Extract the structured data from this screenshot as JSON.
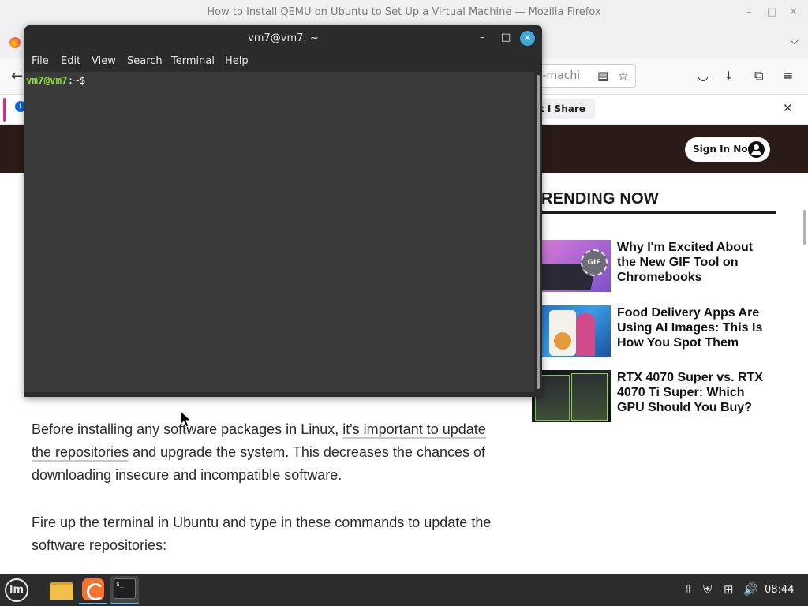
{
  "firefox": {
    "window_title": "How to Install QEMU on Ubuntu to Set Up a Virtual Machine — Mozilla Firefox",
    "minimize_glyph": "–",
    "maximize_glyph": "□",
    "close_glyph": "✕",
    "tab_list_glyph": "⌵",
    "back_glyph": "←",
    "url_visible": "al-machi",
    "reader_glyph": "▤",
    "bookmark_glyph": "☆",
    "pocket_glyph": "◡",
    "download_glyph": "⤓",
    "extensions_glyph": "⧉",
    "menu_glyph": "≡"
  },
  "notification": {
    "info_glyph": "i",
    "share_label": "t I Share",
    "close_glyph": "✕"
  },
  "site": {
    "sign_in_label": "Sign In Now"
  },
  "trending": {
    "title": "RENDING NOW",
    "items": [
      {
        "title": "Why I'm Excited About the New GIF Tool on Chromebooks",
        "thumb_badge": "GIF"
      },
      {
        "title": "Food Delivery Apps Are Using AI Images: This Is How You Spot Them"
      },
      {
        "title": "RTX 4070 Super vs. RTX 4070 Ti Super: Which GPU Should You Buy?"
      }
    ]
  },
  "article": {
    "p1_before": "Before installing any software packages in Linux, ",
    "p1_link": "it's important to update the repositories",
    "p1_after": " and upgrade the system. This decreases the chances of downloading insecure and incompatible software.",
    "p2": "Fire up the terminal in Ubuntu and type in these commands to update the software repositories:"
  },
  "terminal": {
    "title": "vm7@vm7: ~",
    "minimize_glyph": "–",
    "maximize_glyph": "□",
    "close_glyph": "✕",
    "menu": [
      "File",
      "Edit",
      "View",
      "Search",
      "Terminal",
      "Help"
    ],
    "prompt_user": "vm7@vm7",
    "prompt_path": ":~$ "
  },
  "taskbar": {
    "menu_glyph": "lm",
    "terminal_icon_text": "$_",
    "tray": {
      "update_glyph": "⇧",
      "shield_glyph": "⛨",
      "network_glyph": "⊞",
      "volume_glyph": "🔊"
    },
    "clock": "08:44"
  },
  "colors": {
    "terminal_bg": "#3a3a3a",
    "prompt_green": "#8ae234",
    "site_header": "#2a1b18",
    "taskbar": "#2c2c2c",
    "close_blue": "#3fa6d9"
  }
}
